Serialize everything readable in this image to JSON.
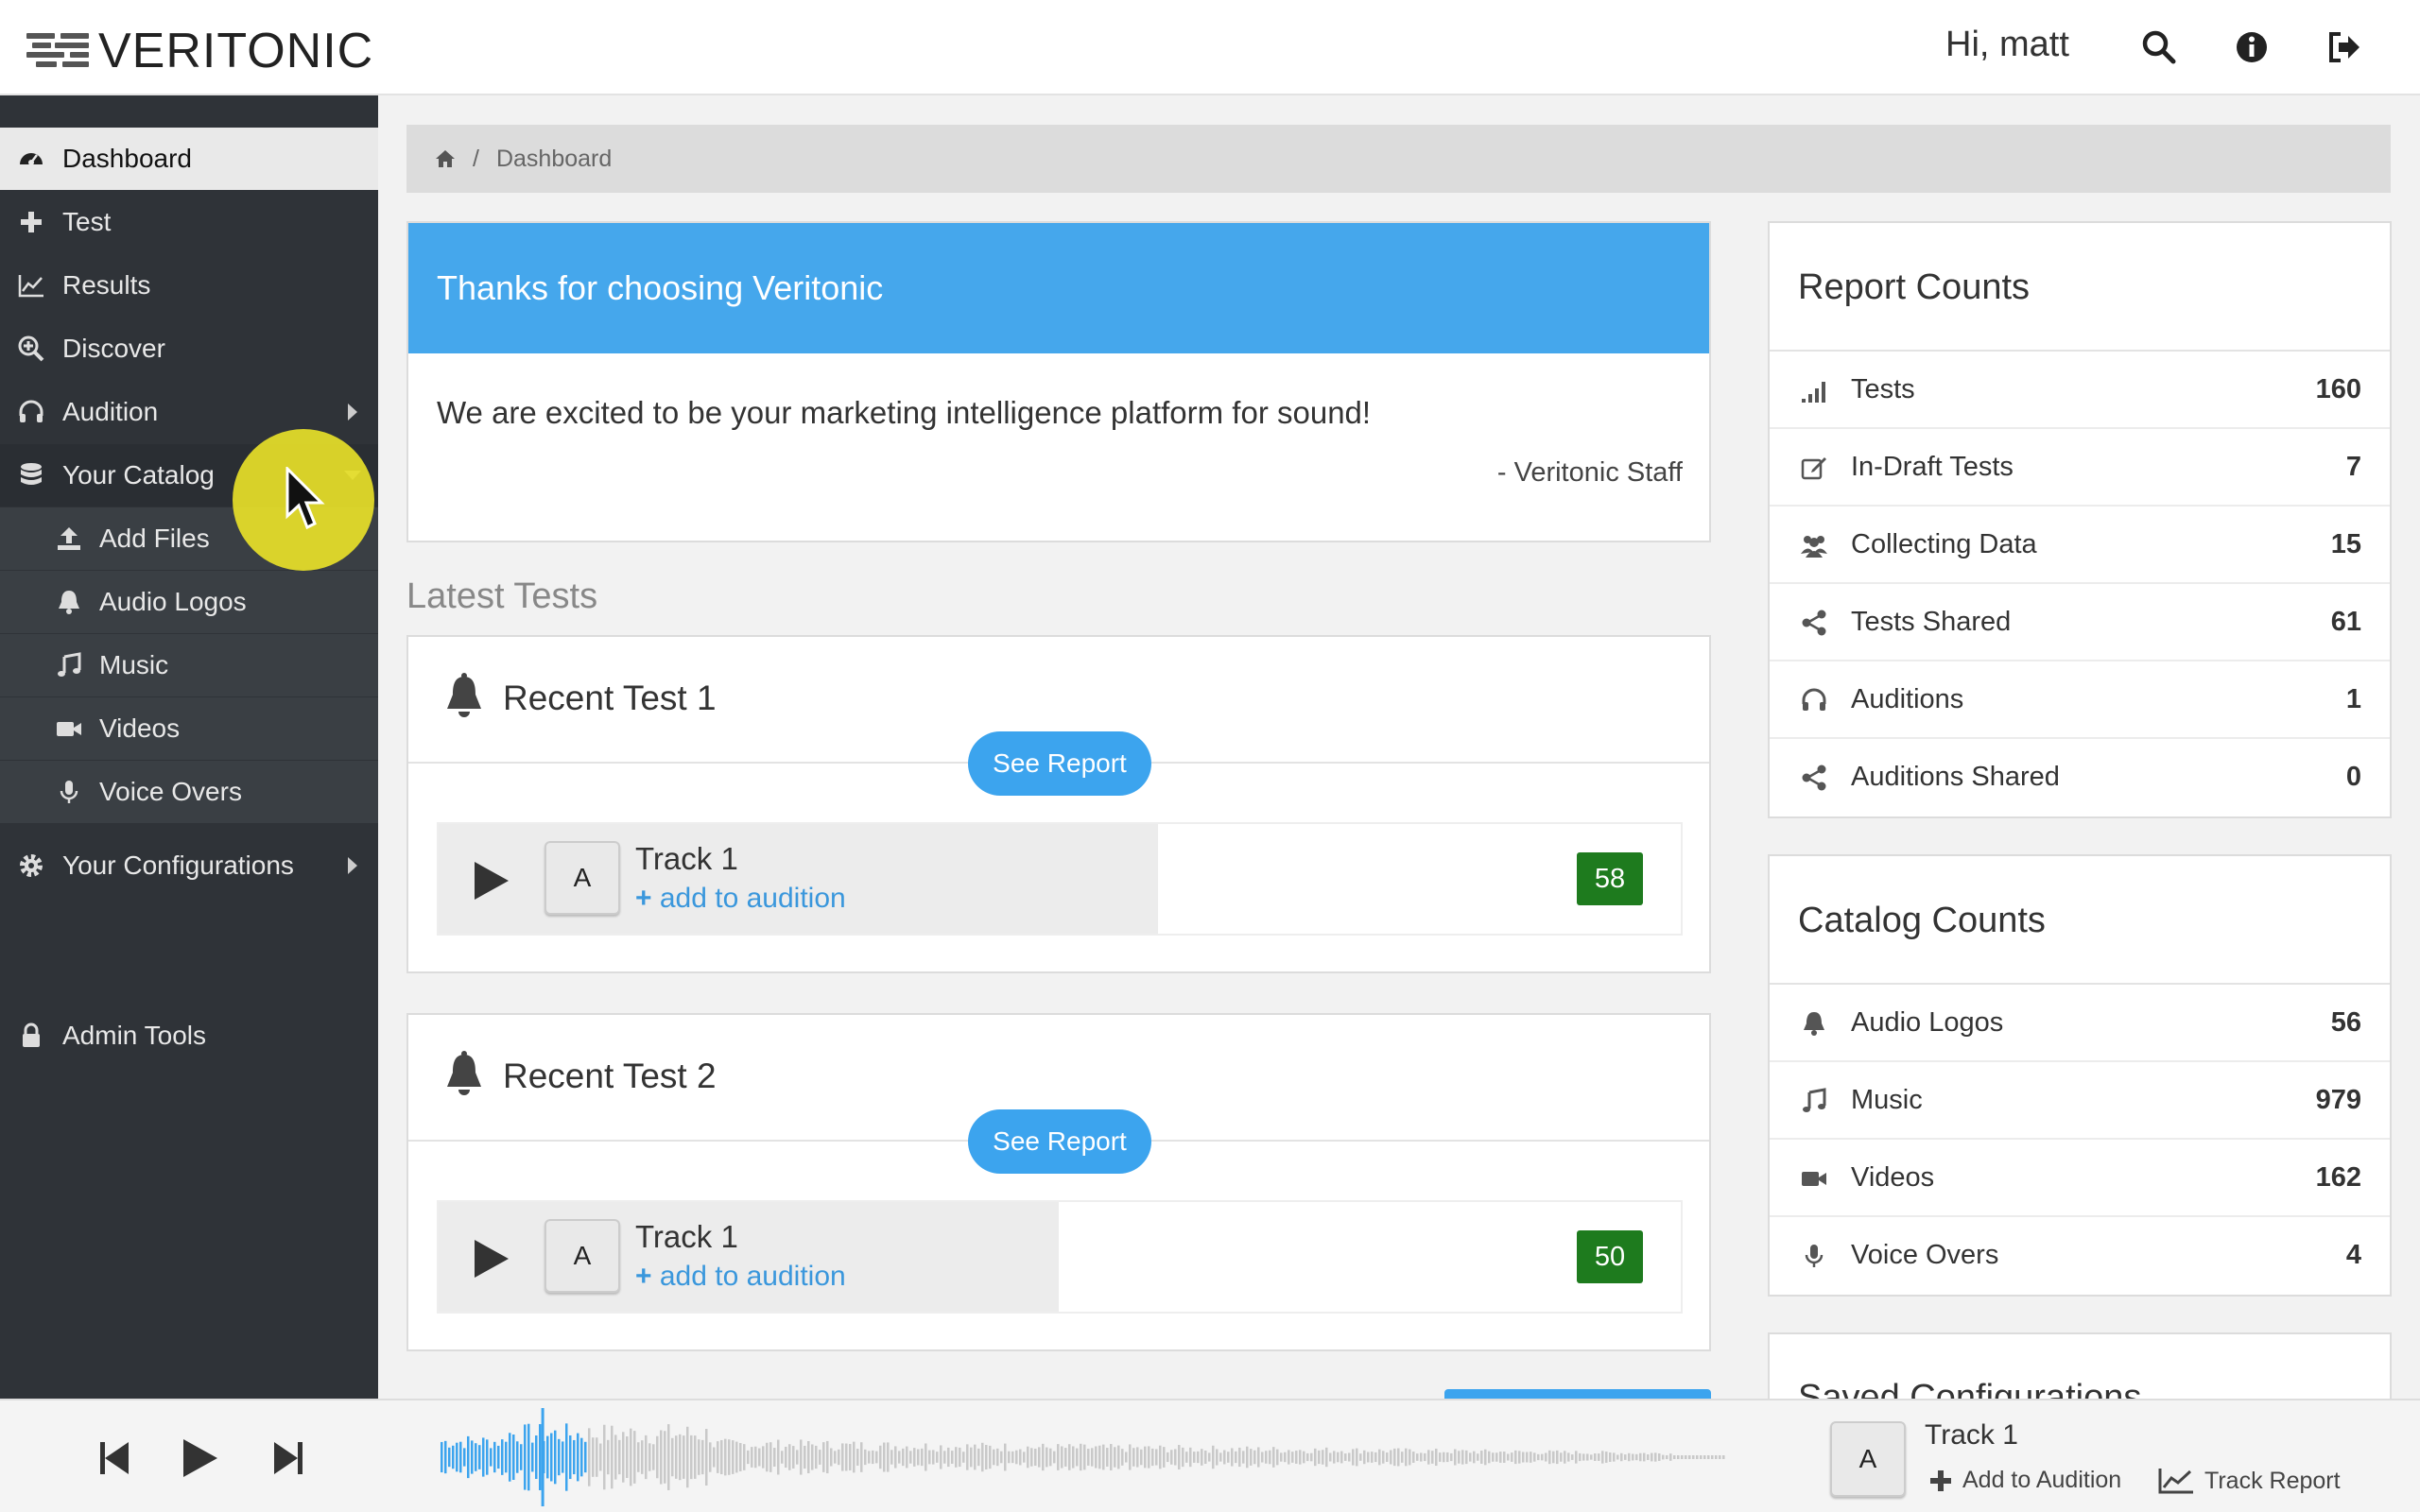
{
  "app": {
    "logo_text": "VERITONIC",
    "greeting": "Hi, matt",
    "header_icons": [
      "search-icon",
      "info-icon",
      "sign-out-icon"
    ]
  },
  "sidebar": {
    "items": [
      {
        "label": "Dashboard",
        "icon": "dashboard-icon",
        "active": true
      },
      {
        "label": "Test",
        "icon": "plus-icon"
      },
      {
        "label": "Results",
        "icon": "line-chart-icon"
      },
      {
        "label": "Discover",
        "icon": "search-plus-icon"
      },
      {
        "label": "Audition",
        "icon": "headphones-icon",
        "has_submenu": true
      },
      {
        "label": "Your Catalog",
        "icon": "database-icon",
        "expanded": true
      },
      {
        "label": "Add Files",
        "icon": "upload-icon",
        "sub": true
      },
      {
        "label": "Audio Logos",
        "icon": "bell-icon",
        "sub": true
      },
      {
        "label": "Music",
        "icon": "music-icon",
        "sub": true
      },
      {
        "label": "Videos",
        "icon": "video-camera-icon",
        "sub": true
      },
      {
        "label": "Voice Overs",
        "icon": "microphone-icon",
        "sub": true
      },
      {
        "label": "Your Configurations",
        "icon": "gear-icon",
        "has_submenu": true
      },
      {
        "label": "Admin Tools",
        "icon": "lock-icon"
      }
    ]
  },
  "breadcrumb": {
    "home_icon": "home-icon",
    "separator": "/",
    "current": "Dashboard"
  },
  "welcome": {
    "title": "Thanks for choosing Veritonic",
    "message": "We are excited to be your marketing intelligence platform for sound!",
    "signature": "- Veritonic Staff"
  },
  "latest_tests": {
    "title": "Latest Tests",
    "tests": [
      {
        "title": "Recent Test 1",
        "button": "See Report",
        "track": {
          "badge": "A",
          "name": "Track 1",
          "action": "add to audition",
          "score": "58"
        }
      },
      {
        "title": "Recent Test 2",
        "button": "See Report",
        "track": {
          "badge": "A",
          "name": "Track 1",
          "action": "add to audition",
          "score": "50"
        }
      }
    ]
  },
  "report_counts": {
    "title": "Report Counts",
    "rows": [
      {
        "label": "Tests",
        "value": "160",
        "icon": "signal-icon"
      },
      {
        "label": "In-Draft Tests",
        "value": "7",
        "icon": "edit-icon"
      },
      {
        "label": "Collecting Data",
        "value": "15",
        "icon": "users-icon"
      },
      {
        "label": "Tests Shared",
        "value": "61",
        "icon": "share-icon"
      },
      {
        "label": "Auditions",
        "value": "1",
        "icon": "headphones-icon"
      },
      {
        "label": "Auditions Shared",
        "value": "0",
        "icon": "share-icon"
      }
    ]
  },
  "catalog_counts": {
    "title": "Catalog Counts",
    "rows": [
      {
        "label": "Audio Logos",
        "value": "56",
        "icon": "bell-icon"
      },
      {
        "label": "Music",
        "value": "979",
        "icon": "music-icon"
      },
      {
        "label": "Videos",
        "value": "162",
        "icon": "video-camera-icon"
      },
      {
        "label": "Voice Overs",
        "value": "4",
        "icon": "microphone-icon"
      }
    ]
  },
  "saved_configurations": {
    "title": "Saved Configurations"
  },
  "player": {
    "badge": "A",
    "track": "Track 1",
    "add_label": "Add to Audition",
    "report_label": "Track Report",
    "progress": 0.12,
    "colors": {
      "played": "#3ca4ee",
      "unplayed": "#c9c9c9",
      "accent": "#45a7ec",
      "score_bg": "#1e7b1e"
    }
  }
}
